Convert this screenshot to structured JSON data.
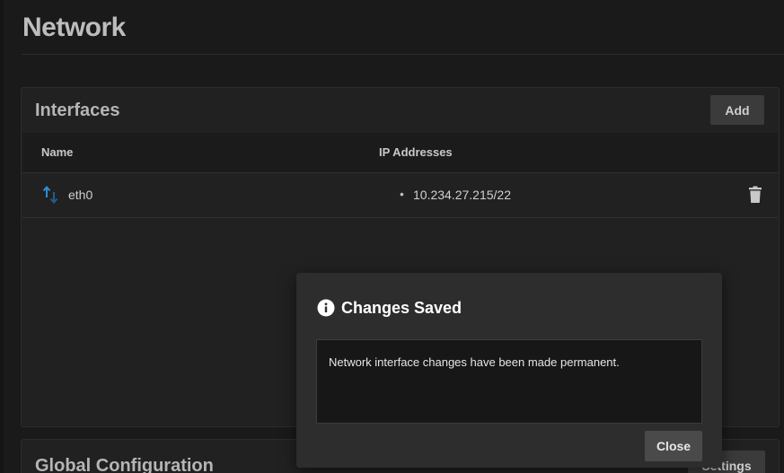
{
  "page": {
    "title": "Network"
  },
  "interfaces_card": {
    "title": "Interfaces",
    "add_label": "Add",
    "columns": {
      "name": "Name",
      "ip_addresses": "IP Addresses"
    },
    "rows": [
      {
        "name": "eth0",
        "ip_addresses": [
          "10.234.27.215/22"
        ],
        "icon": "network-up-down-icon"
      }
    ]
  },
  "global_config_card": {
    "title": "Global Configuration",
    "settings_label": "Settings"
  },
  "dialog": {
    "title": "Changes Saved",
    "icon": "info-icon",
    "message": "Network interface changes have been made permanent.",
    "close_label": "Close"
  },
  "colors": {
    "background": "#1a1a1a",
    "card": "#212121",
    "dialog": "#2d2d2d",
    "icon_blue": "#2b8fd6"
  }
}
